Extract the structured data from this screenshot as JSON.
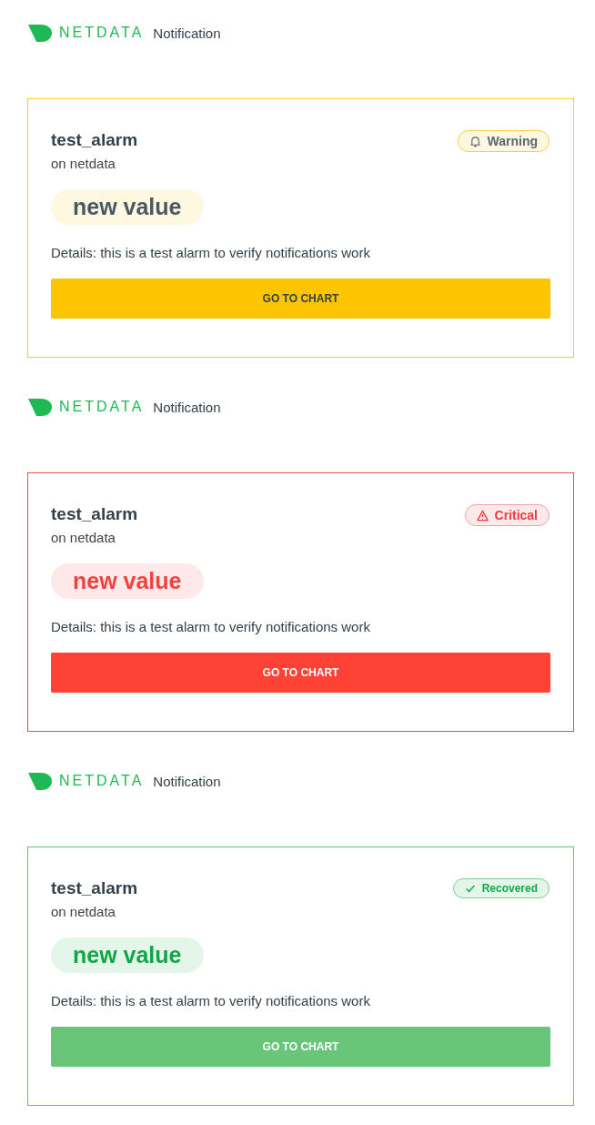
{
  "notifications": [
    {
      "brand": "NETDATA",
      "header_label": "Notification",
      "kind": "warning",
      "badge": "Warning",
      "title": "test_alarm",
      "host": "on netdata",
      "value": "new value",
      "details": "Details: this is a test alarm to verify notifications work",
      "button": "GO TO CHART"
    },
    {
      "brand": "NETDATA",
      "header_label": "Notification",
      "kind": "critical",
      "badge": "Critical",
      "title": "test_alarm",
      "host": "on netdata",
      "value": "new value",
      "details": "Details: this is a test alarm to verify notifications work",
      "button": "GO TO CHART"
    },
    {
      "brand": "NETDATA",
      "header_label": "Notification",
      "kind": "recovered",
      "badge": "Recovered",
      "title": "test_alarm",
      "host": "on netdata",
      "value": "new value",
      "details": "Details: this is a test alarm to verify notifications work",
      "button": "GO TO CHART"
    }
  ]
}
